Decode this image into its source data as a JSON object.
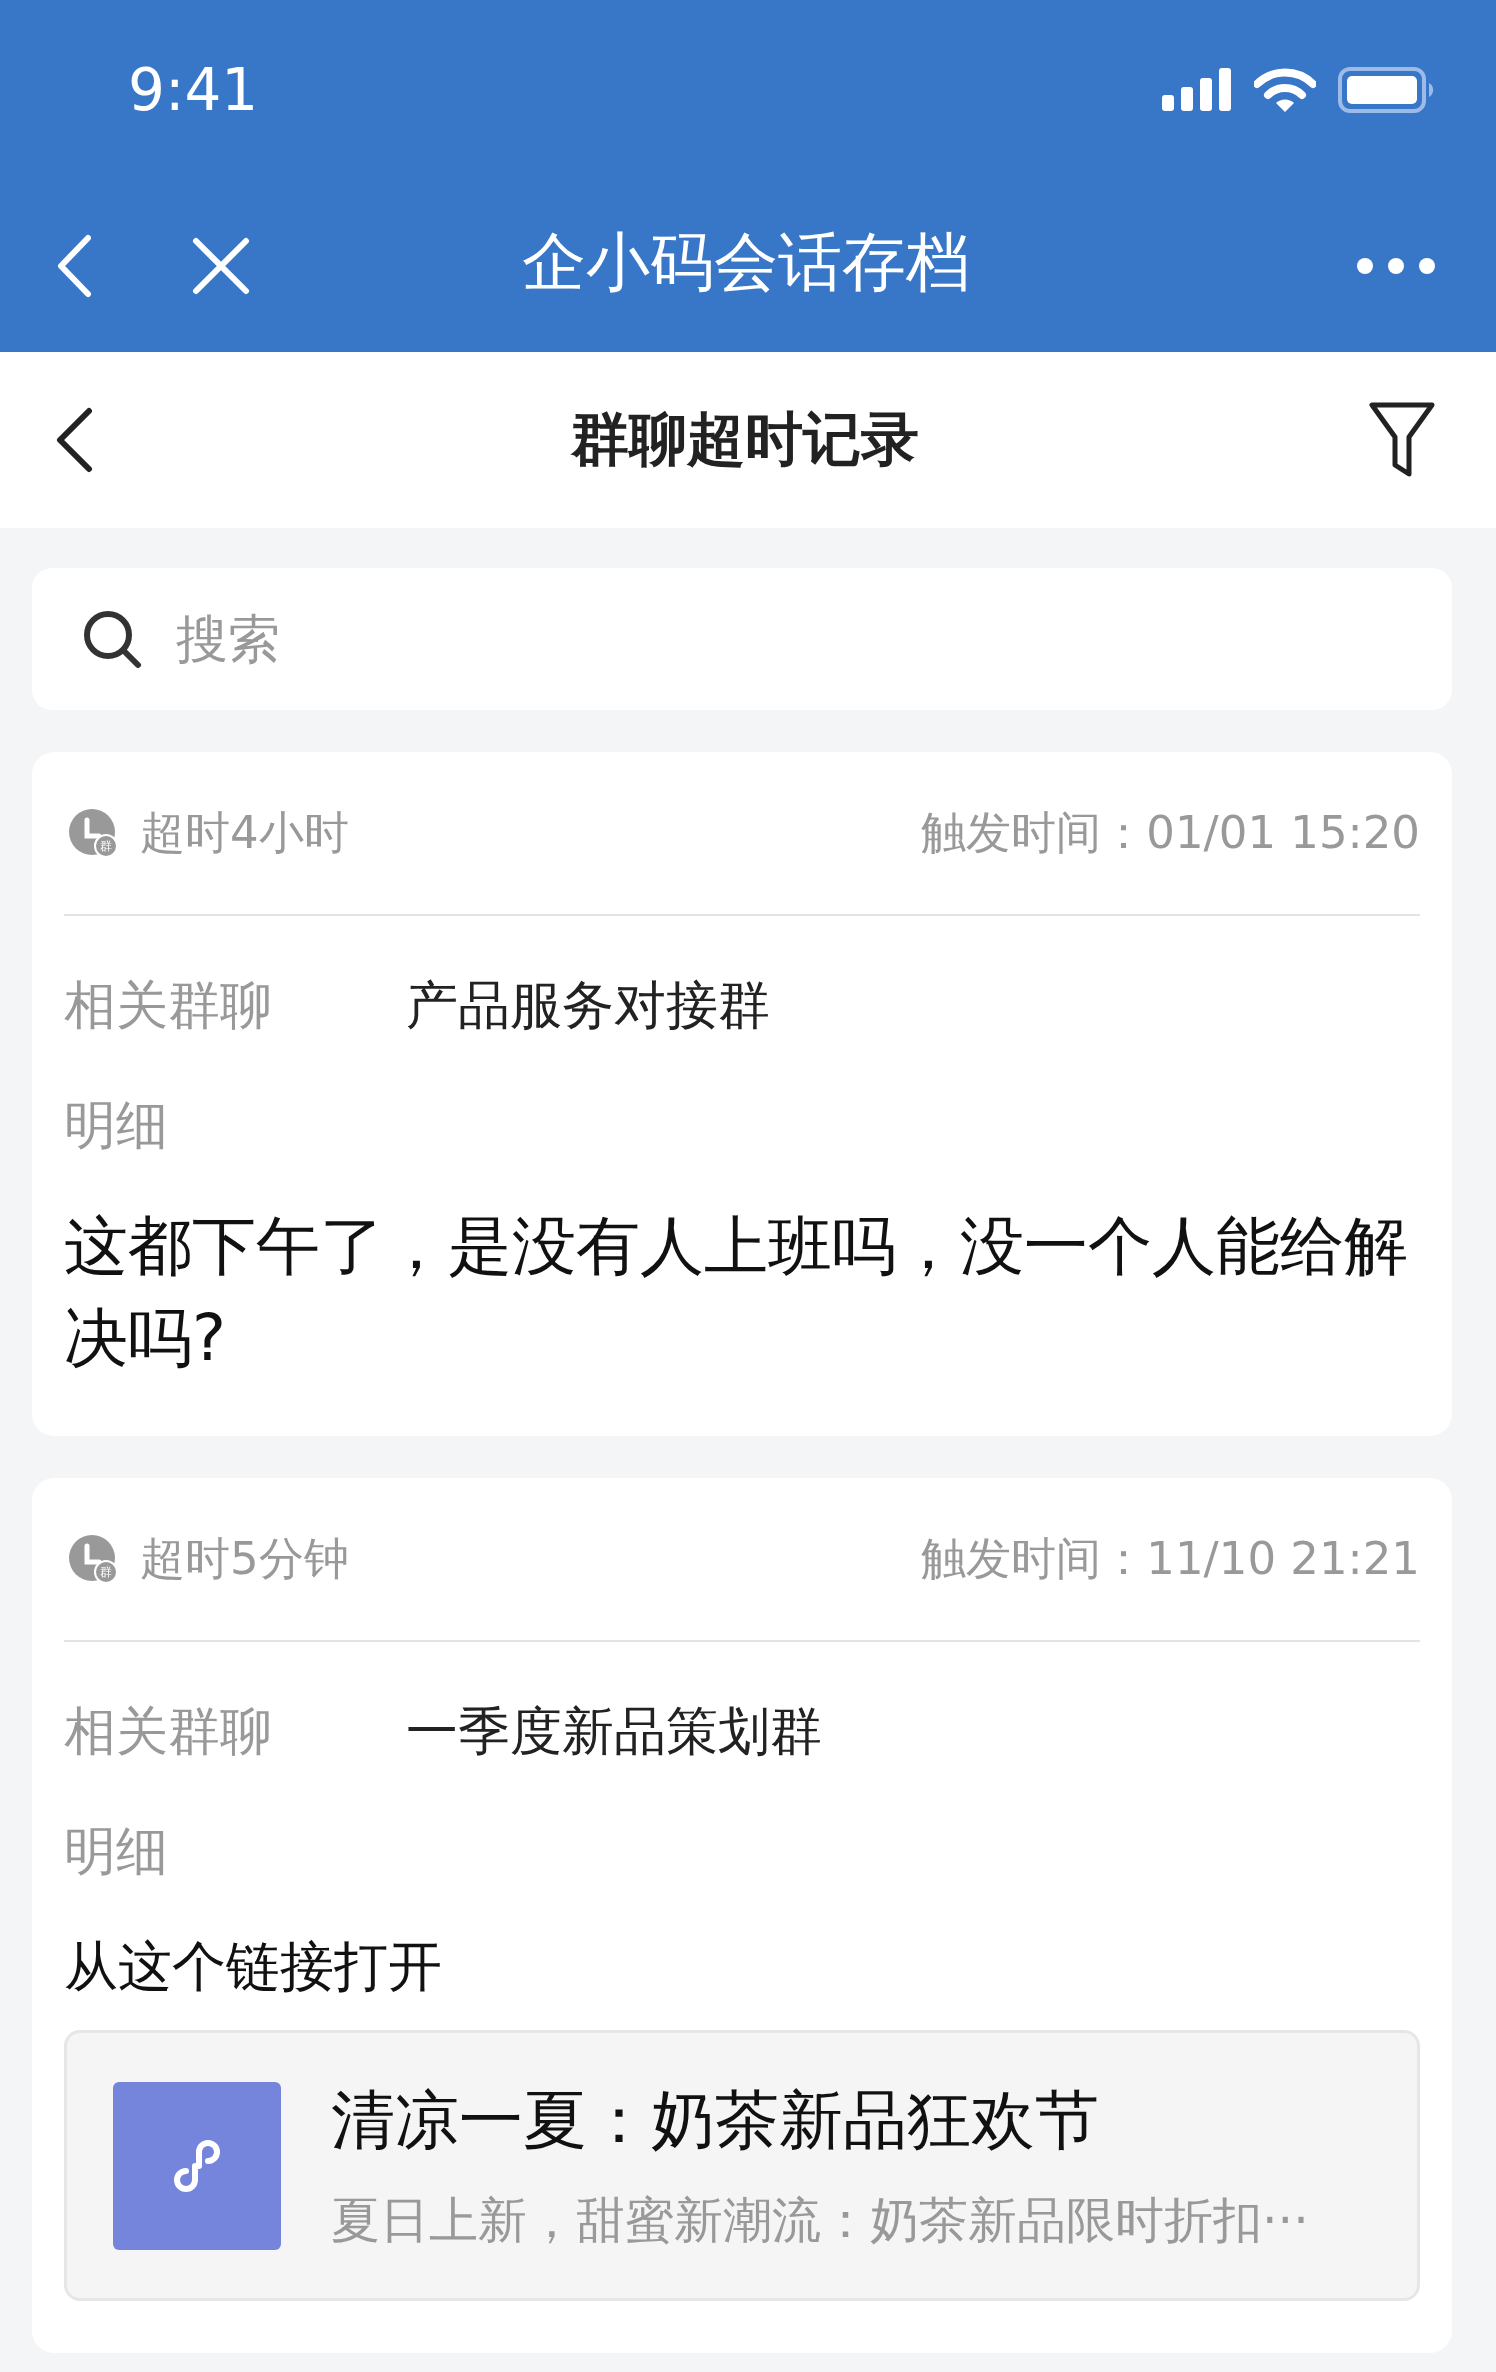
{
  "status_bar": {
    "time": "9:41"
  },
  "nav_bar": {
    "title": "企小码会话存档"
  },
  "header": {
    "title": "群聊超时记录"
  },
  "search": {
    "placeholder": "搜索"
  },
  "records": [
    {
      "overdue": "超时4小时",
      "badge": "群",
      "trigger_time": "触发时间：01/01 15:20",
      "group_label": "相关群聊",
      "group": "产品服务对接群",
      "detail_label": "明细",
      "message": "这都下午了，是没有人上班吗，没一个人能给解决吗?"
    },
    {
      "overdue": "超时5分钟",
      "badge": "群",
      "trigger_time": "触发时间：11/10 21:21",
      "group_label": "相关群聊",
      "group": "一季度新品策划群",
      "detail_label": "明细",
      "message": "从这个链接打开",
      "link": {
        "title": "清凉一夏：奶茶新品狂欢节",
        "description": "夏日上新，甜蜜新潮流：奶茶新品限时折扣···"
      }
    }
  ]
}
